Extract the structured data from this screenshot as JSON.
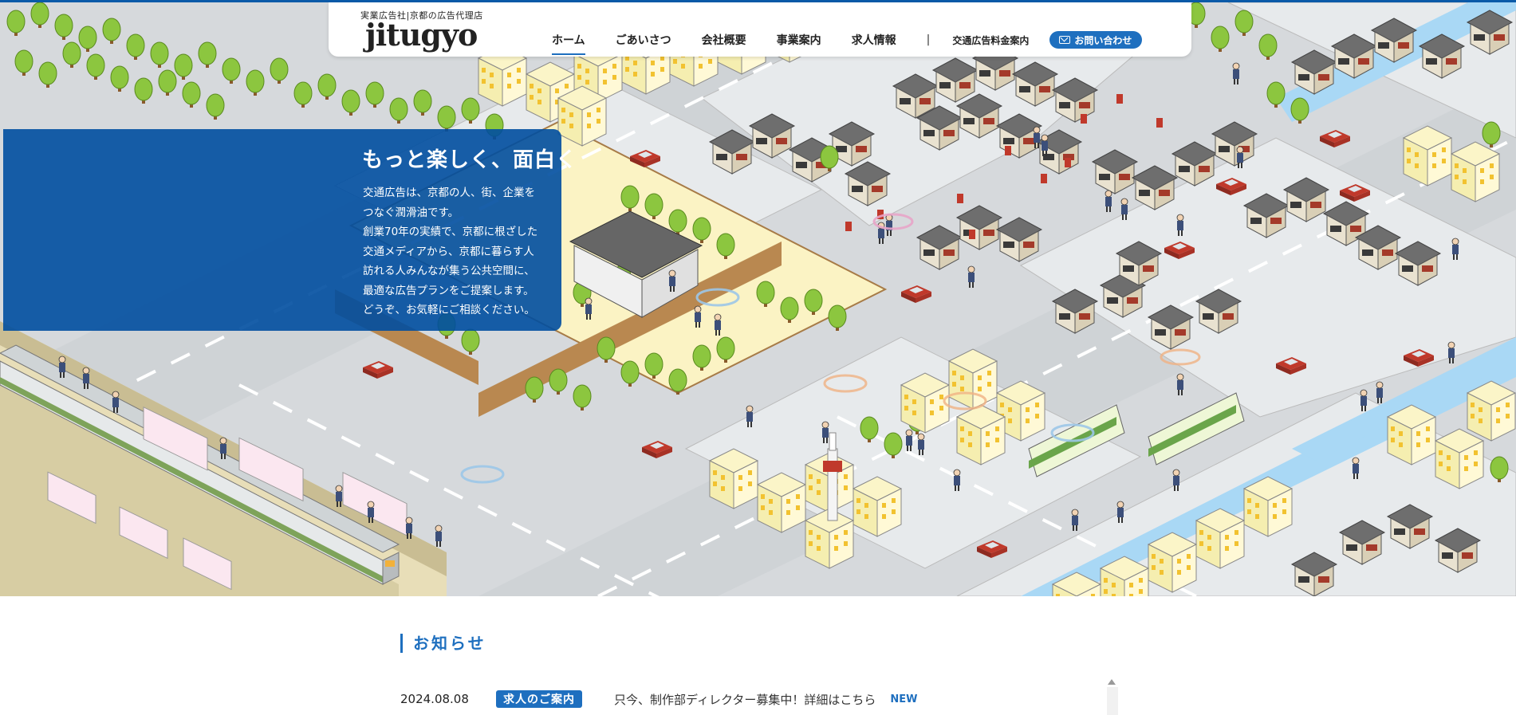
{
  "header": {
    "tagline": "実業広告社|京都の広告代理店",
    "logo_text": "jitugyo",
    "nav": [
      "ホーム",
      "ごあいさつ",
      "会社概要",
      "事業案内",
      "求人情報"
    ],
    "separator": "|",
    "sub_link": "交通広告料金案内",
    "contact_label": "お問い合わせ"
  },
  "hero": {
    "title": "もっと楽しく、面白く",
    "body": [
      "交通広告は、京都の人、街、企業を",
      "つなぐ潤滑油です。",
      "創業70年の実績で、京都に根ざした",
      "交通メディアから、京都に暮らす人",
      "訪れる人みんなが集う公共空間に、",
      "最適な広告プランをご提案します。",
      "どうぞ、お気軽にご相談ください。"
    ]
  },
  "news": {
    "heading": "お知らせ",
    "items": [
      {
        "date": "2024.08.08",
        "tag": "求人のご案内",
        "text": "只今、制作部ディレクター募集中！詳細はこちら",
        "badge": "NEW"
      }
    ]
  },
  "colors": {
    "accent": "#1e6fbf",
    "overlay": "#004ea0",
    "road": "#d6d9dc",
    "sidewalk": "#e9ecee"
  }
}
